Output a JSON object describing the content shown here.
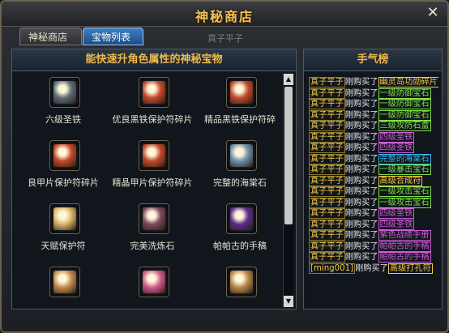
{
  "window": {
    "title": "神秘商店",
    "close_label": "✕"
  },
  "tabs": [
    {
      "label": "神秘商店"
    },
    {
      "label": "宝物列表"
    }
  ],
  "tab_hint": "真子平子",
  "left_panel": {
    "header": "能快速升角色属性的神秘宝物"
  },
  "items": [
    {
      "label": "六级圣铁",
      "icon": "armor-icon",
      "color": "#5a6d7a"
    },
    {
      "label": "优良黑铁保护符碎片",
      "icon": "scroll-icon",
      "color": "#c24a2c"
    },
    {
      "label": "精品黑铁保护符碎",
      "icon": "scroll-icon",
      "color": "#c24a2c"
    },
    {
      "label": "良甲片保护符碎片",
      "icon": "scroll-icon",
      "color": "#c24a2c"
    },
    {
      "label": "精晶甲片保护符碎片",
      "icon": "scroll-icon",
      "color": "#c24a2c"
    },
    {
      "label": "完整的海棠石",
      "icon": "stone-icon",
      "color": "#6f91ad"
    },
    {
      "label": "天赋保护符",
      "icon": "talisman-icon",
      "color": "#d9b56c"
    },
    {
      "label": "完美洗炼石",
      "icon": "rune-icon",
      "color": "#7d4a5f"
    },
    {
      "label": "帕帕古的手稿",
      "icon": "manuscript-icon",
      "color": "#5b2e8b"
    },
    {
      "label": "",
      "icon": "scroll-icon",
      "color": "#c58b4f"
    },
    {
      "label": "",
      "icon": "potion-icon",
      "color": "#d05b8c"
    },
    {
      "label": "",
      "icon": "scroll-icon",
      "color": "#b88a4a"
    }
  ],
  "right_panel": {
    "header": "手气榜"
  },
  "ranking": [
    {
      "name": "真子平子",
      "verb": "刚购买了",
      "item": "幽灵岛功勋碎片",
      "color": "#f5c842"
    },
    {
      "name": "真子平子",
      "verb": "刚购买了",
      "item": "一级防御宝石",
      "color": "#7ee044"
    },
    {
      "name": "真子平子",
      "verb": "刚购买了",
      "item": "一级防御宝石",
      "color": "#7ee044"
    },
    {
      "name": "真子平子",
      "verb": "刚购买了",
      "item": "一级防御宝石",
      "color": "#7ee044"
    },
    {
      "name": "真子平子",
      "verb": "刚购买了",
      "item": "三级攻防石盒",
      "color": "#7ee044"
    },
    {
      "name": "真子平子",
      "verb": "刚购买了",
      "item": "四级圣铁",
      "color": "#d05bd9"
    },
    {
      "name": "真子平子",
      "verb": "刚购买了",
      "item": "四级圣铁",
      "color": "#d05bd9"
    },
    {
      "name": "真子平子",
      "verb": "刚购买了",
      "item": "完整的海棠石",
      "color": "#2fb8e8"
    },
    {
      "name": "真子平子",
      "verb": "刚购买了",
      "item": "一级暴击宝石",
      "color": "#7ee044"
    },
    {
      "name": "真子平子",
      "verb": "刚购买了",
      "item": "高级合成符",
      "color": "#f5c842"
    },
    {
      "name": "真子平子",
      "verb": "刚购买了",
      "item": "一级攻击宝石",
      "color": "#7ee044"
    },
    {
      "name": "真子平子",
      "verb": "刚购买了",
      "item": "一级攻击宝石",
      "color": "#7ee044"
    },
    {
      "name": "真子平子",
      "verb": "刚购买了",
      "item": "四级圣铁",
      "color": "#d05bd9"
    },
    {
      "name": "真子平子",
      "verb": "刚购买了",
      "item": "四级圣铁",
      "color": "#d05bd9"
    },
    {
      "name": "真子平子",
      "verb": "刚购买了",
      "item": "紫色战绩手册",
      "color": "#d05bd9"
    },
    {
      "name": "真子平子",
      "verb": "刚购买了",
      "item": "帕帕古的手稿",
      "color": "#d05bd9"
    },
    {
      "name": "真子平子",
      "verb": "刚购买了",
      "item": "帕帕古的手稿",
      "color": "#d05bd9"
    },
    {
      "name": "[ming001]",
      "verb": "刚购买了",
      "item": "高级打孔符",
      "color": "#f5c842"
    }
  ]
}
